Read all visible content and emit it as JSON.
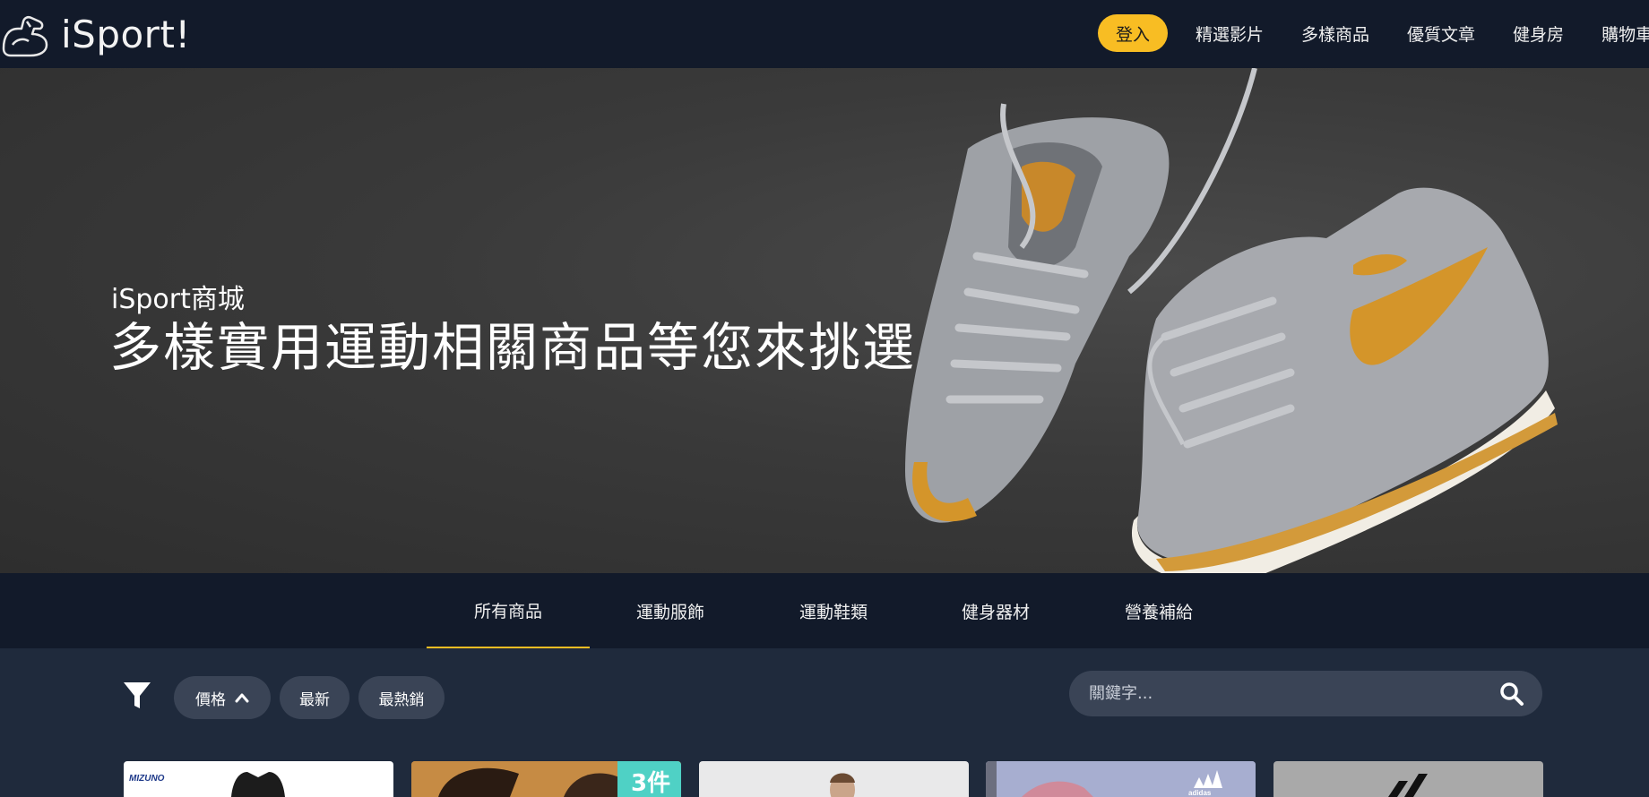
{
  "navbar": {
    "brand": "iSport!",
    "login_label": "登入",
    "links": [
      "精選影片",
      "多樣商品",
      "優質文章",
      "健身房",
      "購物車"
    ],
    "accent_color": "#f8bd23"
  },
  "hero": {
    "subtitle": "iSport商城",
    "title": "多樣實用運動相關商品等您來挑選"
  },
  "categories": {
    "tabs": [
      "所有商品",
      "運動服飾",
      "運動鞋類",
      "健身器材",
      "營養補給"
    ],
    "active_index": 0
  },
  "filters": {
    "price_label": "價格",
    "newest_label": "最新",
    "bestseller_label": "最熱銷"
  },
  "search": {
    "placeholder": "關鍵字..."
  },
  "products": {
    "card2_badge": "3件"
  }
}
